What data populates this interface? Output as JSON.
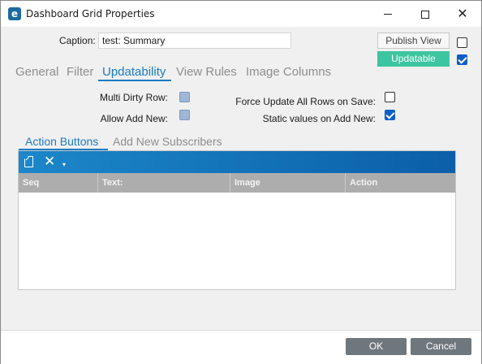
{
  "window": {
    "title": "Dashboard Grid Properties",
    "app_icon_letter": "e",
    "close_glyph": "✕"
  },
  "caption": {
    "label": "Caption:",
    "value": "test: Summary"
  },
  "header_buttons": {
    "publish_view": "Publish View",
    "publish_view_checked": false,
    "updatable": "Updatable",
    "updatable_checked": true,
    "updatable_color": "#3cc59f"
  },
  "main_tabs": [
    {
      "label": "General",
      "active": false
    },
    {
      "label": "Filter",
      "active": false
    },
    {
      "label": "Updatability",
      "active": true
    },
    {
      "label": "View Rules",
      "active": false
    },
    {
      "label": "Image Columns",
      "active": false
    }
  ],
  "options": {
    "multi_dirty_row": {
      "label": "Multi Dirty Row:",
      "checked": false
    },
    "allow_add_new": {
      "label": "Allow Add New:",
      "checked": false
    },
    "force_update_all_rows": {
      "label": "Force Update All Rows on Save:",
      "checked": false
    },
    "static_values_on_add_new": {
      "label": "Static values on Add New:",
      "checked": true
    }
  },
  "sub_tabs": [
    {
      "label": "Action Buttons",
      "active": true
    },
    {
      "label": "Add New Subscribers",
      "active": false
    }
  ],
  "grid": {
    "toolbar_icons": [
      "new-document-icon",
      "delete-icon",
      "dropdown-caret-icon"
    ],
    "toolbar_glyphs": {
      "delete": "✕",
      "caret": "▾"
    },
    "columns": [
      "Seq",
      "Text:",
      "Image",
      "Action"
    ],
    "rows": []
  },
  "footer": {
    "ok": "OK",
    "cancel": "Cancel"
  },
  "colors": {
    "accent": "#1a7bc4",
    "toolbar_start": "#1c87c9",
    "toolbar_end": "#0b5fa8",
    "checkbox_checked": "#0e5ec7",
    "footer_button": "#6f777e"
  }
}
